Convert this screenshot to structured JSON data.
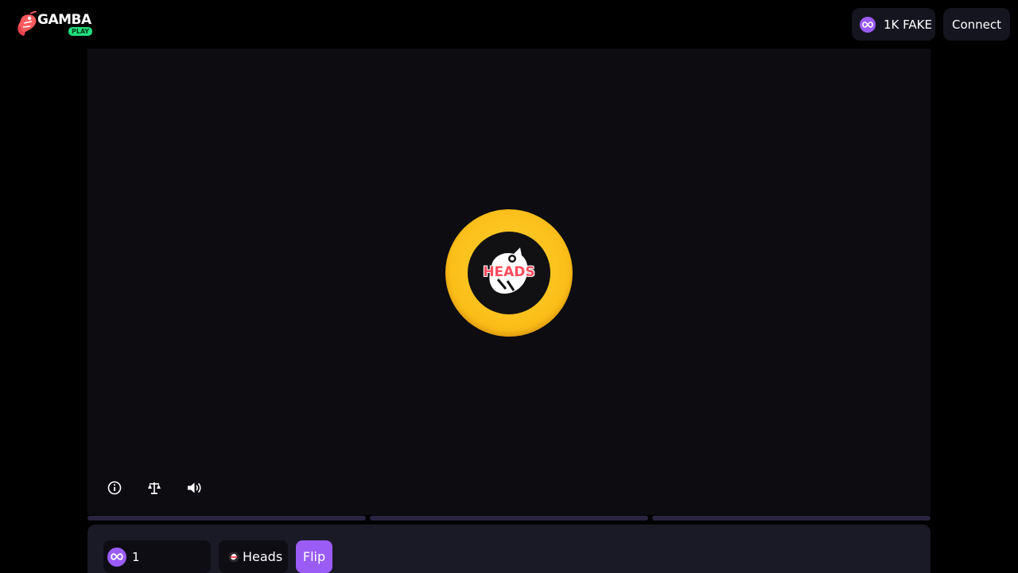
{
  "brand": {
    "name": "GAMBA",
    "badge": "PLAY"
  },
  "header": {
    "token_label": "1K FAKE",
    "connect_label": "Connect"
  },
  "coin": {
    "face_text": "HEADS"
  },
  "stage_icons": [
    "info-icon",
    "scales-icon",
    "speaker-icon"
  ],
  "controls": {
    "wager_value": "1",
    "side_label": "Heads",
    "flip_label": "Flip"
  },
  "colors": {
    "accent": "#9b5cf6",
    "coin_gold": "#fbbf1a",
    "heads_red": "#ff4d5e",
    "play_green": "#21e07c"
  }
}
